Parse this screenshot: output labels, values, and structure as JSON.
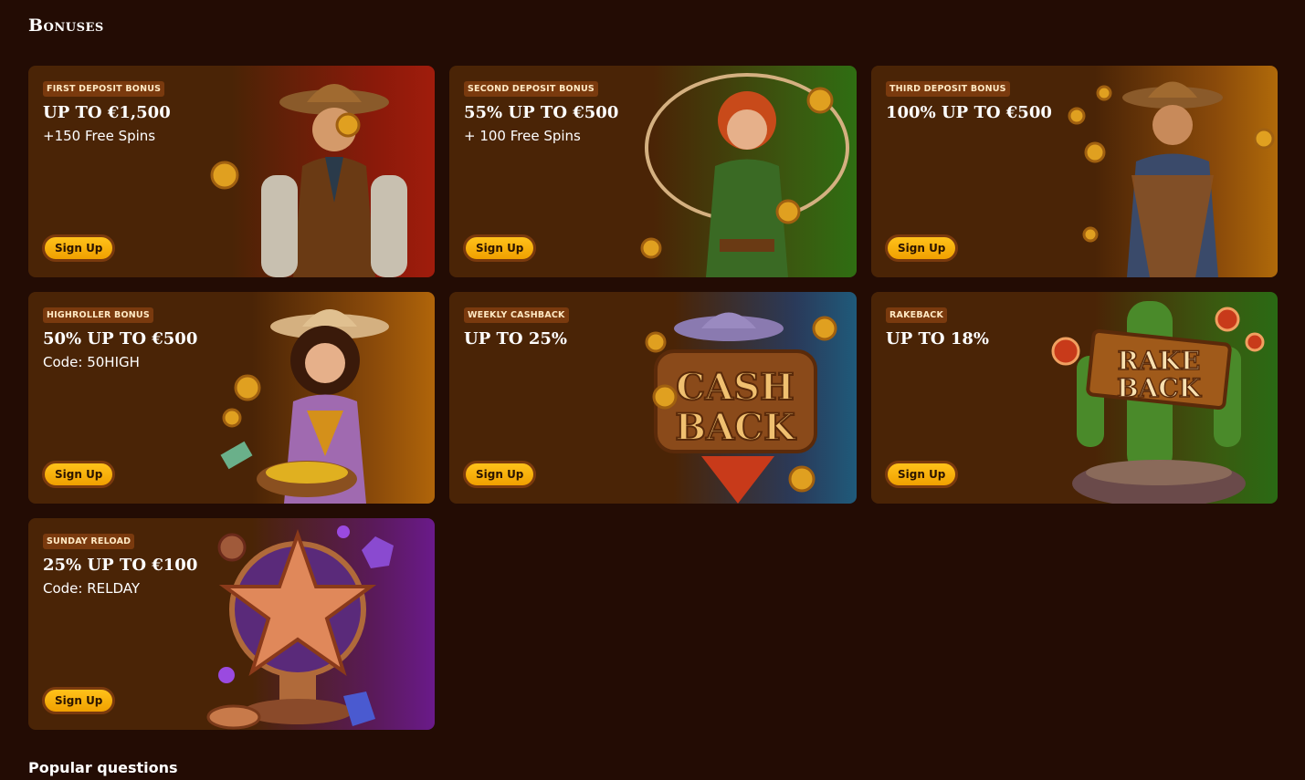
{
  "section_title": "Bonuses",
  "signup_label": "Sign Up",
  "cards": [
    {
      "badge": "First Deposit Bonus",
      "headline": "UP TO €1,500",
      "subline": "+150 Free Spins",
      "art": "cowboy-icon",
      "accent": "#a01c0c"
    },
    {
      "badge": "Second Deposit Bonus",
      "headline": "55% UP TO €500",
      "subline": "+ 100 Free Spins",
      "art": "cowgirl-lasso-icon",
      "accent": "#2f6e12"
    },
    {
      "badge": "Third Deposit Bonus",
      "headline": "100% UP TO €500",
      "subline": "",
      "art": "cowboy-coins-icon",
      "accent": "#b06a0a"
    },
    {
      "badge": "Highroller Bonus",
      "headline": "50% UP TO €500",
      "subline": "Code: 50HIGH",
      "art": "cowgirl-gold-icon",
      "accent": "#b0650a"
    },
    {
      "badge": "Weekly Cashback",
      "headline": "UP TO 25%",
      "subline": "",
      "art": "cashback-sign-icon",
      "accent": "#1f5a7a",
      "art_text": [
        "CASH",
        "BACK"
      ]
    },
    {
      "badge": "Rakeback",
      "headline": "UP TO 18%",
      "subline": "",
      "art": "rakeback-cactus-icon",
      "accent": "#2a6a14",
      "art_text": [
        "RAKE",
        "BACK"
      ]
    },
    {
      "badge": "Sunday Reload",
      "headline": "25% UP TO €100",
      "subline": "Code: RELDAY",
      "art": "sheriff-star-trophy-icon",
      "accent": "#6a1a8a"
    }
  ],
  "faq_title": "Popular questions"
}
